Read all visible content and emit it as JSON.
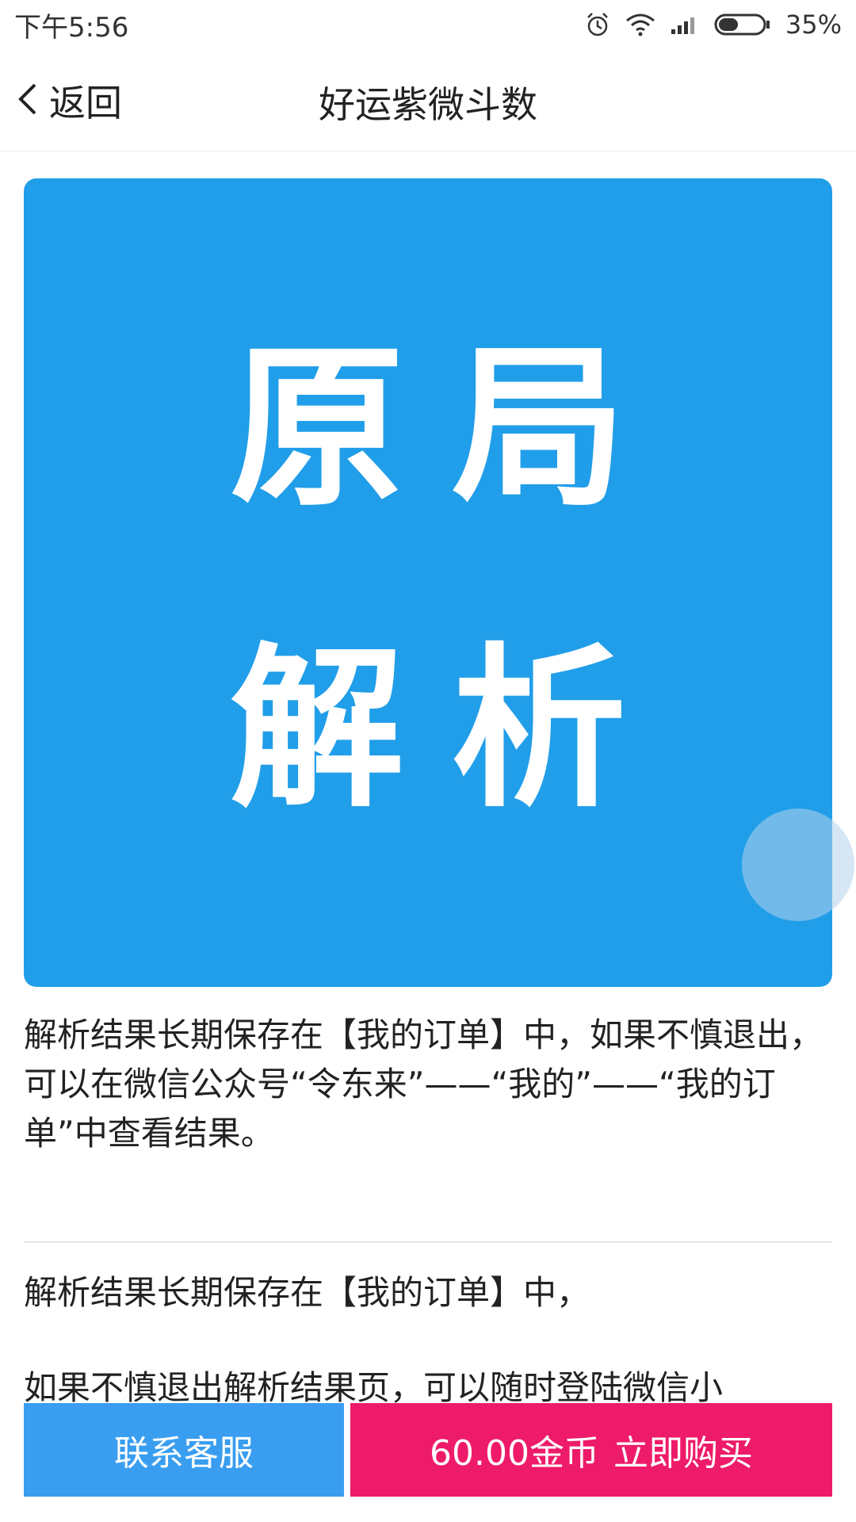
{
  "status_bar": {
    "time": "下午5:56",
    "battery": "35%",
    "icons": [
      "alarm-icon",
      "wifi-icon",
      "signal-icon",
      "battery-icon"
    ]
  },
  "header": {
    "back_label": "返回",
    "title": "好运紫微斗数"
  },
  "banner": {
    "line1": "原局",
    "line2": "解析",
    "background_color": "#219ee9"
  },
  "content": {
    "paragraph1": "解析结果长期保存在【我的订单】中，如果不慎退出，可以在微信公众号“令东来”——“我的”——“我的订单”中查看结果。",
    "paragraph2": "解析结果长期保存在【我的订单】中，",
    "paragraph3": "如果不慎退出解析结果页，可以随时登陆微信小"
  },
  "bottom_bar": {
    "service_label": "联系客服",
    "price": "60.00金币",
    "buy_label": "立即购买",
    "service_color": "#3a9ef0",
    "buy_color": "#ee1b6a"
  }
}
